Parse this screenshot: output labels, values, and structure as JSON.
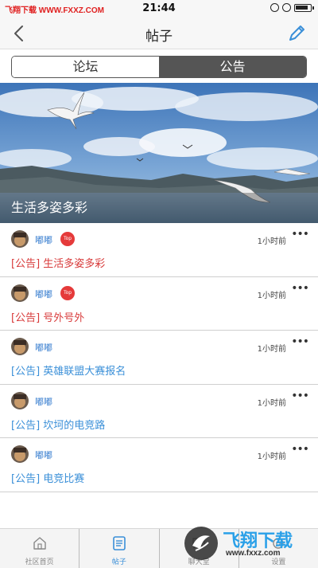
{
  "status_bar": {
    "watermark": "飞翔下载 WWW.FXXZ.COM",
    "time": "21:44"
  },
  "nav": {
    "title": "帖子",
    "back_icon": "chevron-left-icon",
    "edit_icon": "pencil-icon"
  },
  "segment": {
    "tabs": [
      "论坛",
      "公告"
    ],
    "selected": "公告"
  },
  "banner": {
    "caption": "生活多姿多彩"
  },
  "posts": [
    {
      "author": "嘟嘟",
      "badge": "Top",
      "time": "1小时前",
      "title": "[公告] 生活多姿多彩",
      "pinned": true
    },
    {
      "author": "嘟嘟",
      "badge": "Top",
      "time": "1小时前",
      "title": "[公告] 号外号外",
      "pinned": true
    },
    {
      "author": "嘟嘟",
      "badge": "",
      "time": "1小时前",
      "title": "[公告] 英雄联盟大赛报名",
      "pinned": false
    },
    {
      "author": "嘟嘟",
      "badge": "",
      "time": "1小时前",
      "title": "[公告] 坎坷的电竞路",
      "pinned": false
    },
    {
      "author": "嘟嘟",
      "badge": "",
      "time": "1小时前",
      "title": "[公告] 电竞比赛",
      "pinned": false
    }
  ],
  "more_glyph": "•••",
  "tab_bar": {
    "items": [
      {
        "label": "社区首页",
        "icon": "home-icon"
      },
      {
        "label": "帖子",
        "icon": "document-icon",
        "active": true
      },
      {
        "label": "聊大堂",
        "icon": "chat-icon"
      },
      {
        "label": "设置",
        "icon": "gear-icon"
      }
    ]
  },
  "brand_watermark": {
    "name": "飞翔下载",
    "url": "www.fxxz.com"
  },
  "colors": {
    "accent_blue": "#3a8fd8",
    "pinned_red": "#d83a3a",
    "badge_red": "#e53a3a",
    "segment_dark": "#555555"
  }
}
